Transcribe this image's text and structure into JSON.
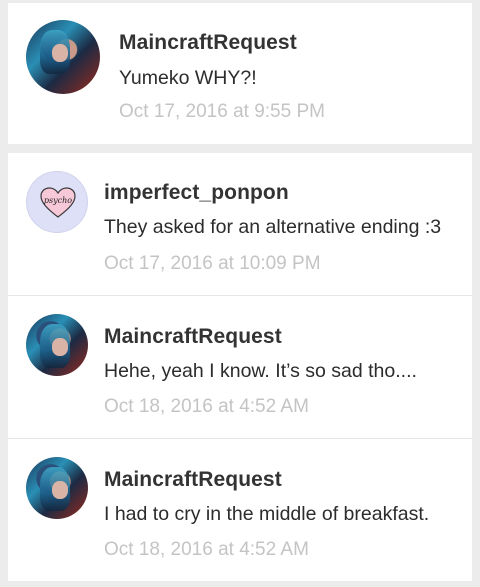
{
  "parent": {
    "username": "MaincraftRequest",
    "message": "Yumeko WHY?!",
    "timestamp": "Oct 17, 2016 at 9:55 PM",
    "avatar_icon": "anime-avatar"
  },
  "replies": [
    {
      "username": "imperfect_ponpon",
      "message": "They asked for an alternative ending :3",
      "timestamp": "Oct 17, 2016 at 10:09 PM",
      "avatar_icon": "psycho-heart-avatar",
      "avatar_text": "psycho"
    },
    {
      "username": "MaincraftRequest",
      "message": "Hehe, yeah I know. It’s so sad tho....",
      "timestamp": "Oct 18, 2016 at 4:52 AM",
      "avatar_icon": "anime-avatar"
    },
    {
      "username": "MaincraftRequest",
      "message": "I had to cry in the middle of breakfast.",
      "timestamp": "Oct 18, 2016 at 4:52 AM",
      "avatar_icon": "anime-avatar"
    }
  ],
  "colors": {
    "background": "#ececec",
    "card": "#ffffff",
    "username": "#333333",
    "timestamp": "#c4c4c4",
    "heart": "#f7c9d8"
  }
}
